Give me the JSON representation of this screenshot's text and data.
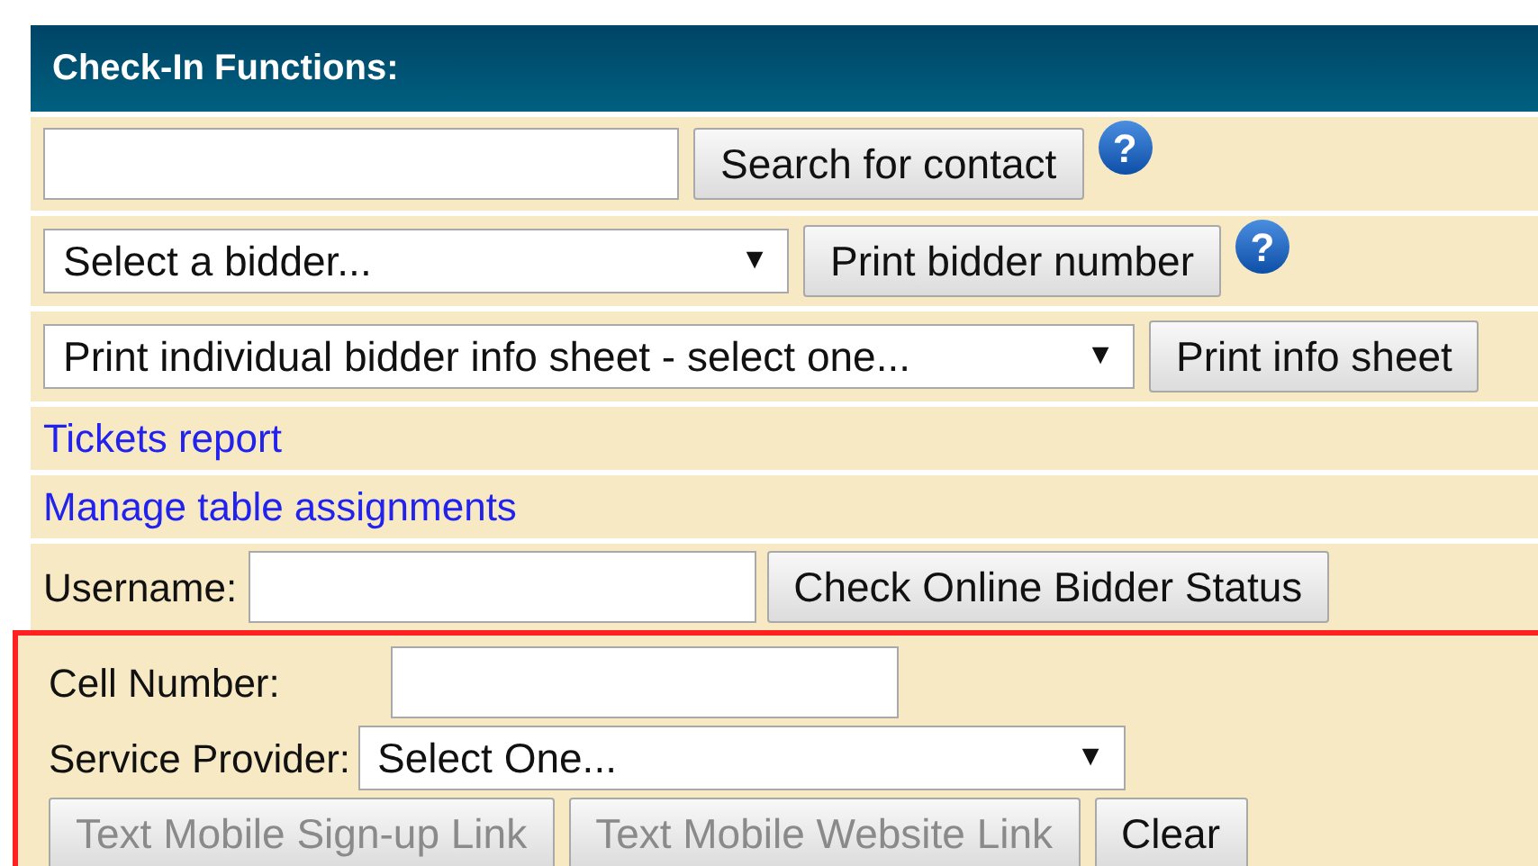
{
  "panel": {
    "title": "Check-In Functions:"
  },
  "rows": [
    {
      "kind": "search",
      "button": "Search for contact",
      "help": "?"
    },
    {
      "kind": "select",
      "value": "Select a bidder...",
      "arrow": "▼",
      "button": "Print bidder number",
      "help": "?"
    },
    {
      "kind": "select",
      "value": "Print individual bidder info sheet - select one...",
      "arrow": "▼",
      "button": "Print info sheet"
    },
    {
      "kind": "link",
      "label": "Tickets report"
    },
    {
      "kind": "link",
      "label": "Manage table assignments"
    },
    {
      "kind": "username",
      "label": "Username:",
      "button": "Check Online Bidder Status"
    }
  ],
  "mobile": {
    "highlighted": true,
    "cell_label": "Cell Number:",
    "provider_label": "Service Provider:",
    "provider_value": "Select One...",
    "arrow": "▼",
    "buttons": [
      {
        "label": "Text Mobile Sign-up Link",
        "disabled": true
      },
      {
        "label": "Text Mobile Website Link",
        "disabled": true
      },
      {
        "label": "Clear",
        "disabled": false
      }
    ]
  }
}
